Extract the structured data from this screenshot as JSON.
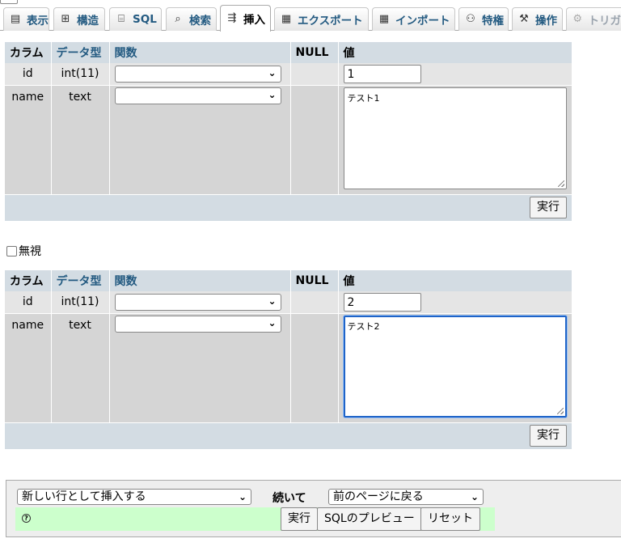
{
  "tabs": [
    {
      "icon": "browse-icon",
      "glyph": "▤",
      "label": "表示"
    },
    {
      "icon": "structure-icon",
      "glyph": "⊞",
      "label": "構造"
    },
    {
      "icon": "sql-icon",
      "glyph": "⌸",
      "label": "SQL"
    },
    {
      "icon": "search-icon",
      "glyph": "⌕",
      "label": "検索"
    },
    {
      "icon": "insert-icon",
      "glyph": "⇶",
      "label": "挿入",
      "active": true
    },
    {
      "icon": "export-icon",
      "glyph": "▦",
      "label": "エクスポート"
    },
    {
      "icon": "import-icon",
      "glyph": "▦",
      "label": "インポート"
    },
    {
      "icon": "privileges-icon",
      "glyph": "⚇",
      "label": "特権"
    },
    {
      "icon": "operations-icon",
      "glyph": "⚒",
      "label": "操作"
    },
    {
      "icon": "triggers-icon",
      "glyph": "⚙",
      "label": "トリガ"
    }
  ],
  "headers": {
    "column": "カラム",
    "type": "データ型",
    "function": "関数",
    "null": "NULL",
    "value": "値"
  },
  "row1": {
    "fields": [
      {
        "name": "id",
        "type": "int(11)",
        "function": "",
        "value": "1"
      },
      {
        "name": "name",
        "type": "text",
        "function": "",
        "value": "テスト1"
      }
    ],
    "go": "実行"
  },
  "ignore_label": "無視",
  "row2": {
    "fields": [
      {
        "name": "id",
        "type": "int(11)",
        "function": "",
        "value": "2"
      },
      {
        "name": "name",
        "type": "text",
        "function": "",
        "value": "テスト2"
      }
    ],
    "go": "実行"
  },
  "bottom": {
    "insert_mode": "新しい行として挿入する",
    "and_then": "続いて",
    "after_insert": "前のページに戻る",
    "go": "実行",
    "preview_sql": "SQLのプレビュー",
    "reset": "リセット",
    "help_glyph": "?"
  }
}
